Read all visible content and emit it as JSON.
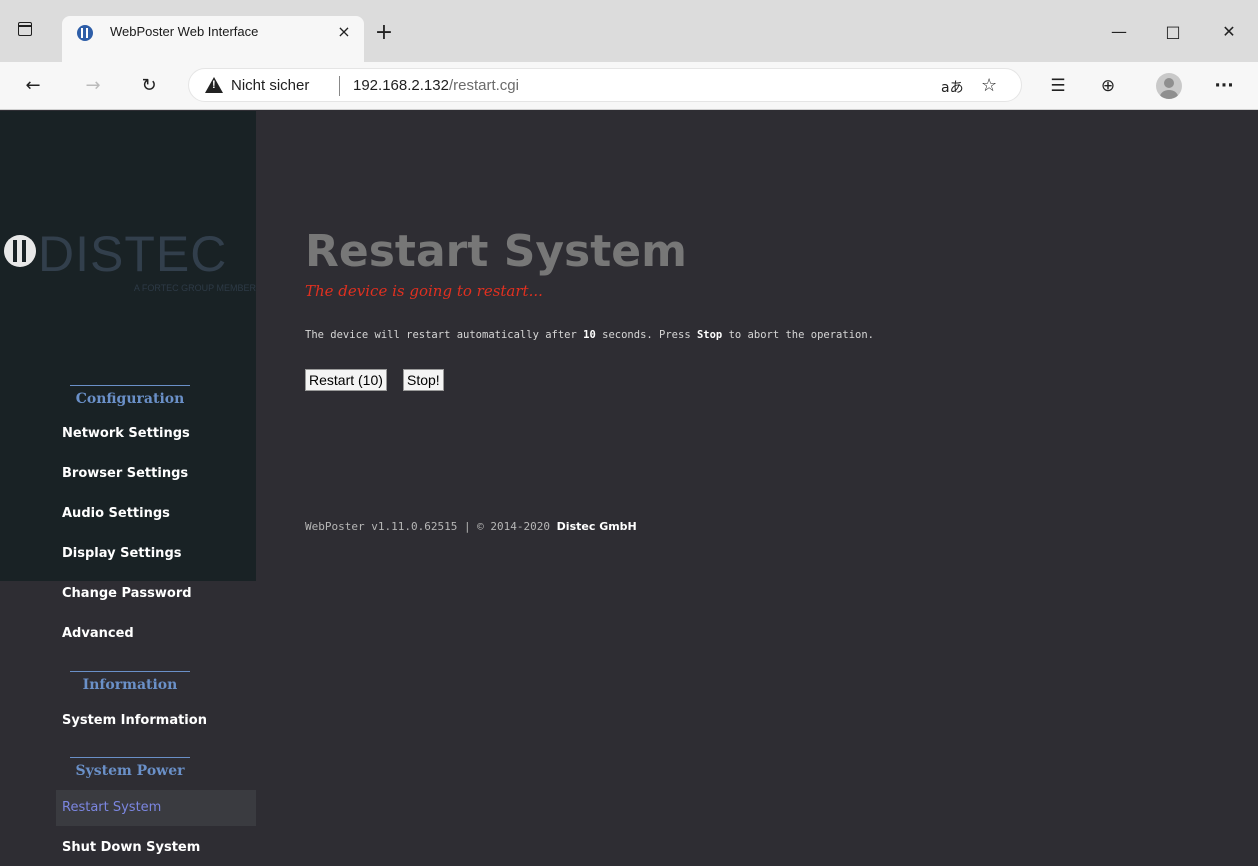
{
  "browser": {
    "tab_title": "WebPoster Web Interface",
    "tab_close": "×",
    "new_tab": "+",
    "window_min": "—",
    "window_max": "□",
    "window_close": "✕",
    "security_label": "Nicht sicher",
    "url_host": "192.168.2.132",
    "url_path": "/restart.cgi",
    "icons": [
      "tab-actions-icon",
      "favicon-icon",
      "back-icon",
      "forward-icon",
      "reload-icon",
      "warning-icon",
      "read-aloud-icon",
      "add-favorite-icon",
      "favorites-icon",
      "collections-icon",
      "profile-icon",
      "menu-icon"
    ]
  },
  "logo": {
    "word": "DISTEC",
    "tagline": "A FORTEC GROUP MEMBER"
  },
  "sidebar": {
    "sections": [
      {
        "heading": "Configuration",
        "items": [
          "Network Settings",
          "Browser Settings",
          "Audio Settings",
          "Display Settings",
          "Change Password",
          "Advanced"
        ]
      },
      {
        "heading": "Information",
        "items": [
          "System Information"
        ]
      },
      {
        "heading": "System Power",
        "items": [
          "Restart System",
          "Shut Down System"
        ]
      }
    ],
    "active_item": "Restart System"
  },
  "main": {
    "title": "Restart System",
    "subtitle": "The device is going to restart...",
    "description": {
      "part1": "The device will restart automatically after ",
      "seconds": "10",
      "part2": " seconds. Press ",
      "stop_word": "Stop",
      "part3": " to abort the operation."
    },
    "restart_button": "Restart (10)",
    "stop_button": "Stop!",
    "footer": {
      "version": "WebPoster v1.11.0.62515 | © 2014-2020 ",
      "company": "Distec GmbH"
    }
  },
  "colors": {
    "page_bg": "#2e2d33",
    "sidebar_bg": "#192225",
    "heading_blue": "#6a90c8",
    "active_item": "#7b86e0",
    "subtitle_red": "#e03020",
    "title_gray": "#777777"
  }
}
